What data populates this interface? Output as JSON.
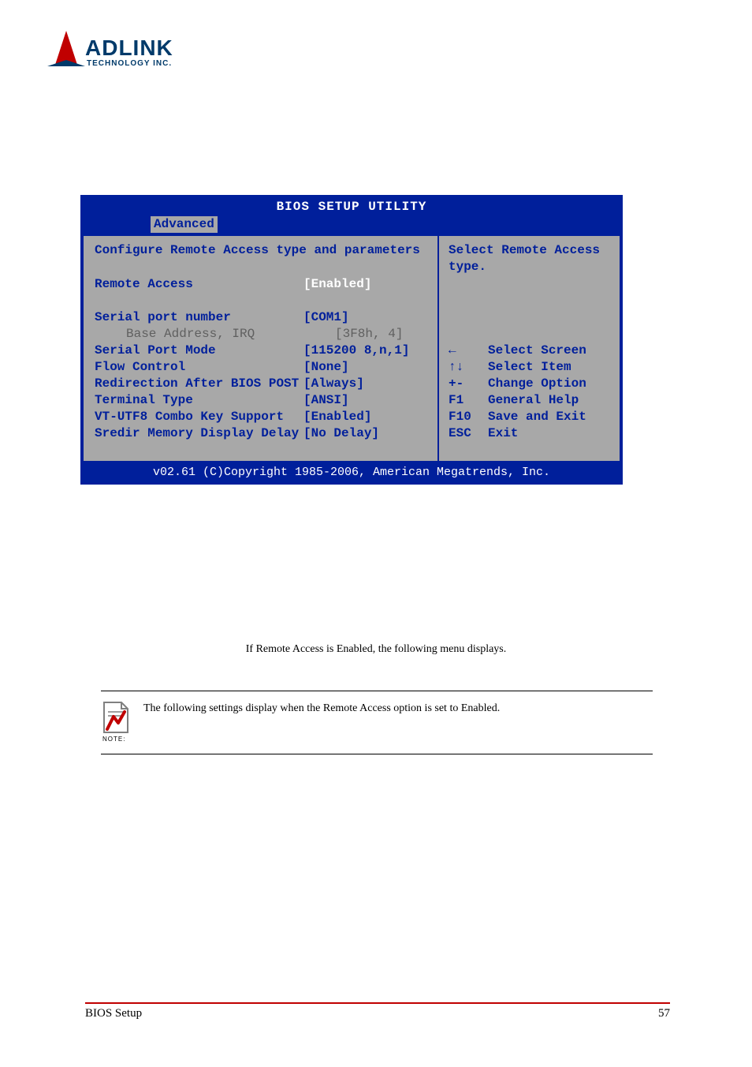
{
  "bios": {
    "title": "BIOS SETUP UTILITY",
    "tab": "Advanced",
    "heading": "Configure Remote Access type and parameters",
    "items": [
      {
        "label": "Remote Access",
        "value": "[Enabled]",
        "selected": true,
        "dim": false,
        "indent": false
      },
      {
        "spacer": true
      },
      {
        "label": "Serial port number",
        "value": "[COM1]",
        "selected": false,
        "dim": false,
        "indent": false
      },
      {
        "label": "Base Address, IRQ",
        "value": "[3F8h, 4]",
        "selected": false,
        "dim": true,
        "indent": true
      },
      {
        "label": "Serial Port Mode",
        "value": "[115200 8,n,1]",
        "selected": false,
        "dim": false,
        "indent": false
      },
      {
        "label": "Flow Control",
        "value": "[None]",
        "selected": false,
        "dim": false,
        "indent": false
      },
      {
        "label": "Redirection After BIOS POST",
        "value": "[Always]",
        "selected": false,
        "dim": false,
        "indent": false
      },
      {
        "label": "Terminal Type",
        "value": "[ANSI]",
        "selected": false,
        "dim": false,
        "indent": false
      },
      {
        "label": "VT-UTF8 Combo Key Support",
        "value": "[Enabled]",
        "selected": false,
        "dim": false,
        "indent": false
      },
      {
        "label": "Sredir Memory Display Delay",
        "value": "[No Delay]",
        "selected": false,
        "dim": false,
        "indent": false
      }
    ],
    "help": {
      "text_line1": "Select Remote Access",
      "text_line2": "type.",
      "keys": [
        {
          "k": "←",
          "desc": "Select Screen"
        },
        {
          "k": "↑↓",
          "desc": "Select Item"
        },
        {
          "k": "+-",
          "desc": "Change Option"
        },
        {
          "k": "F1",
          "desc": "General Help"
        },
        {
          "k": "F10",
          "desc": "Save and Exit"
        },
        {
          "k": "ESC",
          "desc": "Exit"
        }
      ]
    },
    "footer": "v02.61 (C)Copyright 1985-2006, American Megatrends, Inc."
  },
  "caption": "If Remote Access is Enabled, the following menu displays.",
  "note": {
    "label": "NOTE:",
    "text": "The following settings display when the Remote Access option is set to Enabled."
  },
  "page_footer": {
    "left": "BIOS Setup",
    "right": "57"
  }
}
